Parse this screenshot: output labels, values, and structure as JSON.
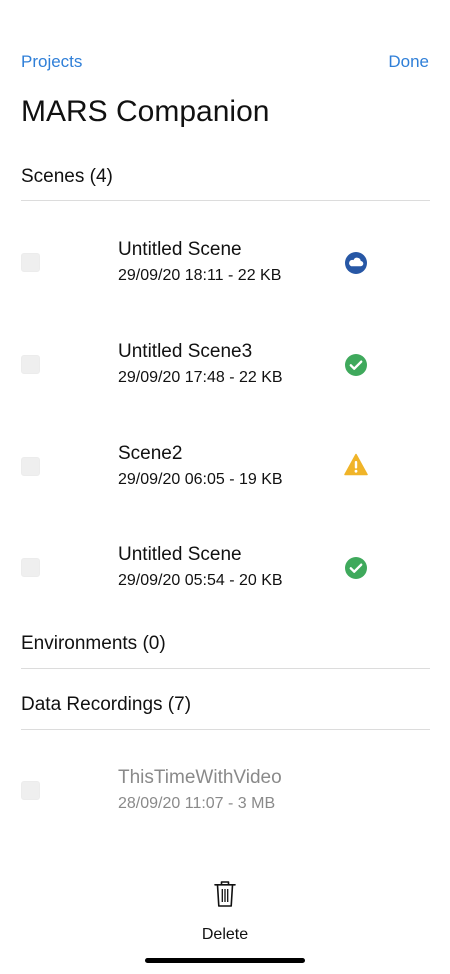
{
  "nav": {
    "back_label": "Projects",
    "done_label": "Done"
  },
  "title": "MARS Companion",
  "sections": {
    "scenes": {
      "header": "Scenes (4)"
    },
    "environments": {
      "header": "Environments (0)"
    },
    "data_recordings": {
      "header": "Data Recordings (7)"
    }
  },
  "scenes": [
    {
      "name": "Untitled Scene",
      "meta": "29/09/20 18:11 - 22 KB",
      "status": "cloud-icon",
      "status_color": "#2757a5"
    },
    {
      "name": "Untitled Scene3",
      "meta": "29/09/20 17:48 - 22 KB",
      "status": "check-icon",
      "status_color": "#3fa95c"
    },
    {
      "name": "Scene2",
      "meta": "29/09/20 06:05 - 19 KB",
      "status": "warning-icon",
      "status_color": "#f0b429"
    },
    {
      "name": "Untitled Scene",
      "meta": "29/09/20 05:54 - 20 KB",
      "status": "check-icon",
      "status_color": "#3fa95c"
    }
  ],
  "recordings": [
    {
      "name": "ThisTimeWithVideo",
      "meta": "28/09/20 11:07 - 3 MB"
    }
  ],
  "toolbar": {
    "delete_label": "Delete",
    "delete_icon": "trash-icon"
  },
  "colors": {
    "accent": "#2f7fd8",
    "divider": "#dcdcdc",
    "muted_text": "#8a8a8a"
  }
}
